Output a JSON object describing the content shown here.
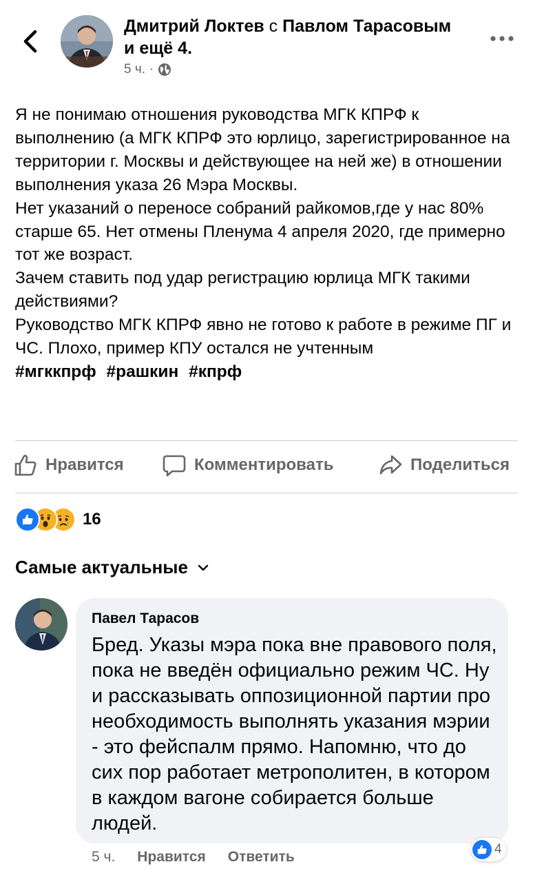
{
  "header": {
    "author_name": "Дмитрий Локтев",
    "with_word": "с",
    "tagged_name": "Павлом Тарасовым",
    "and_more": "и ещё 4.",
    "time": "5 ч.",
    "separator": "·",
    "privacy_icon": "globe-icon",
    "back_icon": "chevron-left-icon",
    "more_icon": "more-dots-icon"
  },
  "post": {
    "paragraphs": [
      "Я не понимаю отношения руководства МГК КПРФ к выполнению (а МГК КПРФ это юрлицо, зарегистрированное на территории г. Москвы и действующее на ней же) в отношении выполнения указа 26 Мэра Москвы.",
      "Нет указаний о переносе собраний райкомов,где у нас 80% старше 65. Нет отмены Пленума 4 апреля 2020, где примерно тот же возраст.",
      "Зачем ставить под удар регистрацию юрлица МГК такими действиями?",
      "Руководство МГК КПРФ явно не готово к работе в режиме ПГ и ЧС. Плохо, пример КПУ остался не учтенным"
    ],
    "hashtags": [
      "#мгккпрф",
      "#рашкин",
      "#кпрф"
    ]
  },
  "actions": {
    "like_label": "Нравится",
    "comment_label": "Комментировать",
    "share_label": "Поделиться"
  },
  "reactions": {
    "types": [
      "like",
      "wow",
      "sad"
    ],
    "count": "16"
  },
  "sort": {
    "label": "Самые актуальные"
  },
  "comment": {
    "author": "Павел Тарасов",
    "text": "Бред. Указы мэра пока вне правового поля, пока не введён официально режим ЧС. Ну и рассказывать оппозиционной партии про необходимость выполнять указания мэрии - это фейспалм прямо. Напомню, что до сих пор работает метрополитен, в котором в каждом вагоне собирается больше людей.",
    "time": "5 ч.",
    "like_label": "Нравится",
    "reply_label": "Ответить",
    "likes_count": "4"
  },
  "colors": {
    "text": "#050505",
    "secondary": "#65676b",
    "bubble": "#f0f2f5",
    "like_blue": "#1877f2",
    "reaction_yellow": "#f7b125",
    "divider": "#ced0d4"
  }
}
